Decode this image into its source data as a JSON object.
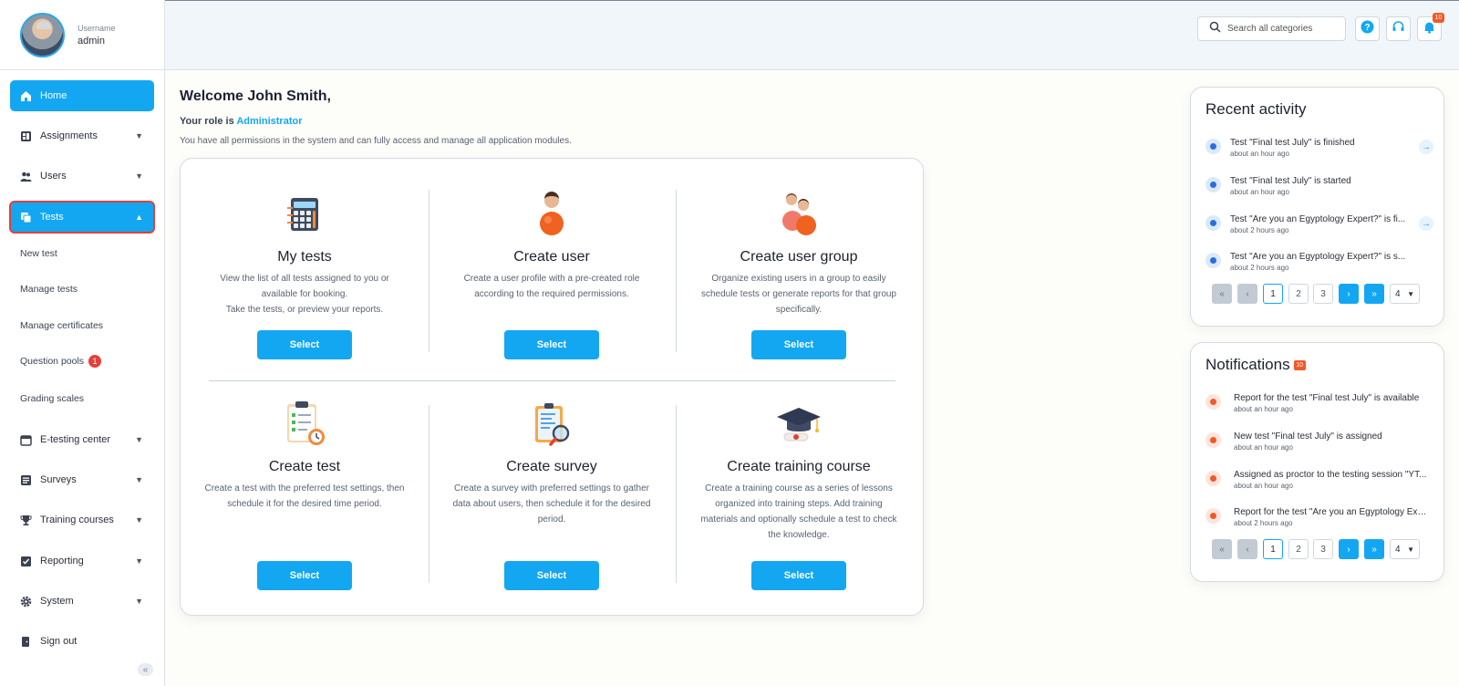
{
  "profile": {
    "label": "Username",
    "name": "admin"
  },
  "nav": {
    "home": "Home",
    "assignments": "Assignments",
    "users": "Users",
    "tests": "Tests",
    "tests_sub": [
      "New test",
      "Manage tests",
      "Manage certificates",
      "Question pools",
      "Grading scales"
    ],
    "question_pools_badge": "1",
    "etesting": "E-testing center",
    "surveys": "Surveys",
    "training": "Training courses",
    "reporting": "Reporting",
    "system": "System",
    "signout": "Sign out"
  },
  "header": {
    "search_placeholder": "Search all categories",
    "notifications_count": "10"
  },
  "main": {
    "welcome": "Welcome John Smith,",
    "role_prefix": "Your role is ",
    "role": "Administrator",
    "permissions": "You have all permissions in the system and can fully access and manage all application modules."
  },
  "cards": [
    {
      "title": "My tests",
      "desc": "View the list of all tests assigned to you or available for booking.\nTake the tests, or preview your reports.",
      "button": "Select"
    },
    {
      "title": "Create user",
      "desc": "Create a user profile with a pre-created role according to the required permissions.",
      "button": "Select"
    },
    {
      "title": "Create user group",
      "desc": "Organize existing users in a group to easily schedule tests or generate reports for that group specifically.",
      "button": "Select"
    },
    {
      "title": "Create test",
      "desc": "Create a test with the preferred test settings, then schedule it for the desired time period.",
      "button": "Select"
    },
    {
      "title": "Create survey",
      "desc": "Create a survey with preferred settings to gather data about users, then schedule it for the desired period.",
      "button": "Select"
    },
    {
      "title": "Create training course",
      "desc": "Create a training course as a series of lessons organized into training steps. Add training materials and optionally schedule a test to check the knowledge.",
      "button": "Select"
    }
  ],
  "recent_activity": {
    "title": "Recent activity",
    "items": [
      {
        "text": "Test \"Final test July\" is finished",
        "time": "about an hour ago"
      },
      {
        "text": "Test \"Final test July\" is started",
        "time": "about an hour ago"
      },
      {
        "text": "Test \"Are you an Egyptology Expert?\" is fi...",
        "time": "about 2 hours ago"
      },
      {
        "text": "Test \"Are you an Egyptology Expert?\" is s...",
        "time": "about 2 hours ago"
      }
    ],
    "pages": [
      "1",
      "2",
      "3"
    ],
    "page_size": "4"
  },
  "notifications": {
    "title": "Notifications",
    "badge": "10",
    "items": [
      {
        "text": "Report for the test \"Final test July\" is available",
        "time": "about an hour ago"
      },
      {
        "text": "New test \"Final test July\" is assigned",
        "time": "about an hour ago"
      },
      {
        "text": "Assigned as proctor to the testing session \"YT...",
        "time": "about an hour ago"
      },
      {
        "text": "Report for the test \"Are you an Egyptology Exp...",
        "time": "about 2 hours ago"
      }
    ],
    "pages": [
      "1",
      "2",
      "3"
    ],
    "page_size": "4"
  },
  "colors": {
    "accent": "#13a7f2",
    "alert": "#f05a28",
    "badge": "#e2403a"
  }
}
